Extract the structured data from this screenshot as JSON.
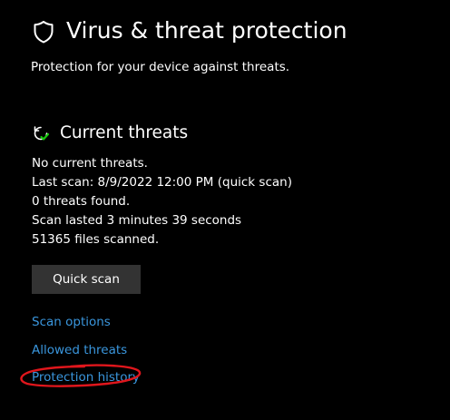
{
  "header": {
    "icon": "shield-icon",
    "title": "Virus & threat protection",
    "subtitle": "Protection for your device against threats."
  },
  "current_threats": {
    "icon": "refresh-check-icon",
    "title": "Current threats",
    "lines": [
      "No current threats.",
      "Last scan: 8/9/2022 12:00 PM (quick scan)",
      "0 threats found.",
      "Scan lasted 3 minutes 39 seconds",
      "51365 files scanned."
    ],
    "quick_scan_label": "Quick scan"
  },
  "links": {
    "scan_options": "Scan options",
    "allowed_threats": "Allowed threats",
    "protection_history": "Protection history"
  },
  "colors": {
    "background": "#000000",
    "text": "#ffffff",
    "link": "#3a96dd",
    "button": "#333333",
    "check_green": "#16c60c",
    "annotation": "#e0161c"
  }
}
